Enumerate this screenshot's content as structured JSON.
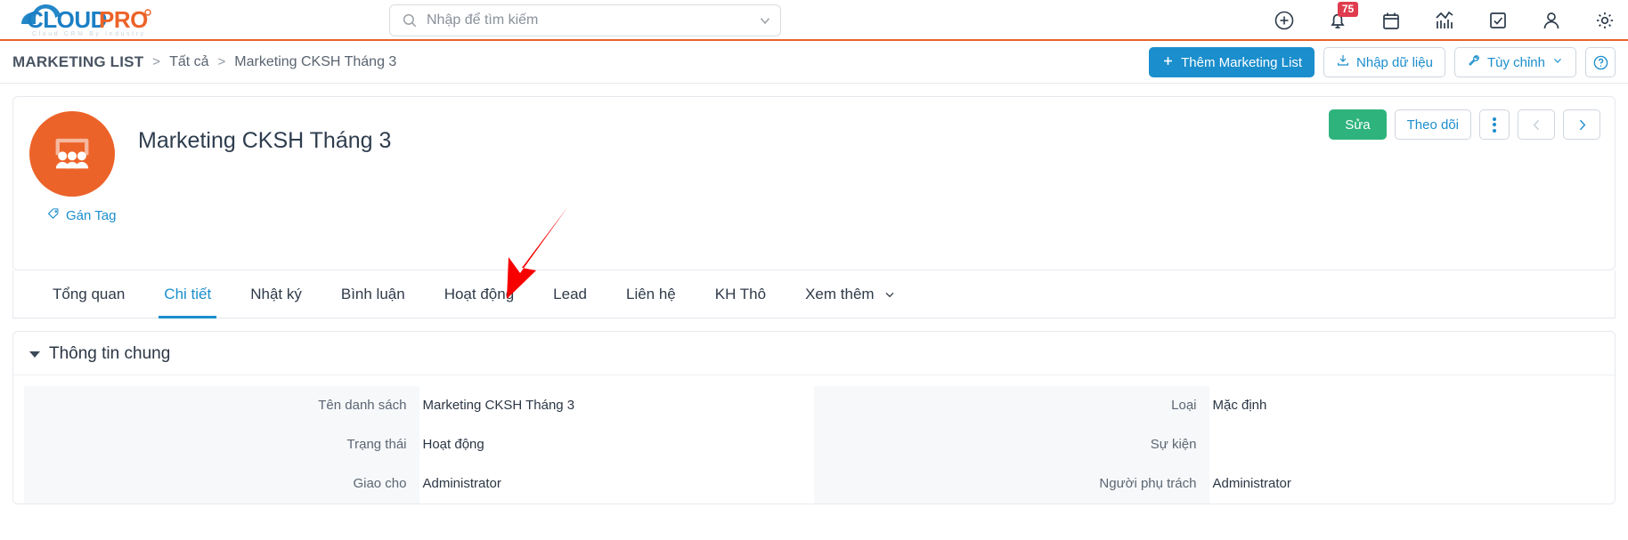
{
  "brand": {
    "name_cloud": "CLOUD",
    "name_pro": "PRO",
    "tagline": "Cloud CRM By Industry",
    "color_blue": "#1b7fc4",
    "color_orange": "#ec6329"
  },
  "search": {
    "placeholder": "Nhập để tìm kiếm",
    "value": "",
    "icon": "search-icon",
    "caret_icon": "chevron-down-icon"
  },
  "header_icons": [
    {
      "name": "add-circle-icon",
      "label": "Thêm mới"
    },
    {
      "name": "bell-icon",
      "label": "Thông báo",
      "badge": "75"
    },
    {
      "name": "calendar-icon",
      "label": "Lịch"
    },
    {
      "name": "analytics-icon",
      "label": "Báo cáo"
    },
    {
      "name": "task-check-icon",
      "label": "Công việc"
    },
    {
      "name": "user-icon",
      "label": "Tài khoản"
    },
    {
      "name": "gear-icon",
      "label": "Cài đặt"
    }
  ],
  "breadcrumb": {
    "root": "MARKETING LIST",
    "separator": ">",
    "items": [
      "Tất cả",
      "Marketing CKSH Tháng 3"
    ]
  },
  "crumb_actions": {
    "add_label": "Thêm Marketing List",
    "import_label": "Nhập dữ liệu",
    "customize_label": "Tùy chỉnh",
    "help_label": "?"
  },
  "record": {
    "title": "Marketing CKSH Tháng 3",
    "avatar_icon": "audience-presentation-icon",
    "avatar_color": "#ec6329",
    "tag_label": "Gán Tag",
    "tag_icon": "tag-icon",
    "edit_label": "Sửa",
    "follow_label": "Theo dõi",
    "more_icon": "vertical-dots-icon",
    "prev_icon": "chevron-left-icon",
    "next_icon": "chevron-right-icon",
    "edit_color": "#2eb37c"
  },
  "tabs": [
    {
      "label": "Tổng quan",
      "active": false
    },
    {
      "label": "Chi tiết",
      "active": true
    },
    {
      "label": "Nhật ký",
      "active": false
    },
    {
      "label": "Bình luận",
      "active": false
    },
    {
      "label": "Hoạt động",
      "active": false
    },
    {
      "label": "Lead",
      "active": false
    },
    {
      "label": "Liên hệ",
      "active": false
    },
    {
      "label": "KH Thô",
      "active": false
    },
    {
      "label": "Xem thêm",
      "active": false,
      "has_caret": true
    }
  ],
  "detail": {
    "section_title": "Thông tin chung",
    "left_fields": [
      {
        "label": "Tên danh sách",
        "value": "Marketing CKSH Tháng 3"
      },
      {
        "label": "Trạng thái",
        "value": "Hoạt động"
      },
      {
        "label": "Giao cho",
        "value": "Administrator"
      }
    ],
    "right_fields": [
      {
        "label": "Loại",
        "value": "Mặc định"
      },
      {
        "label": "Sự kiện",
        "value": ""
      },
      {
        "label": "Người phụ trách",
        "value": "Administrator"
      }
    ]
  },
  "annotation": {
    "arrow_color": "#f70000",
    "points_to": "Lead"
  }
}
